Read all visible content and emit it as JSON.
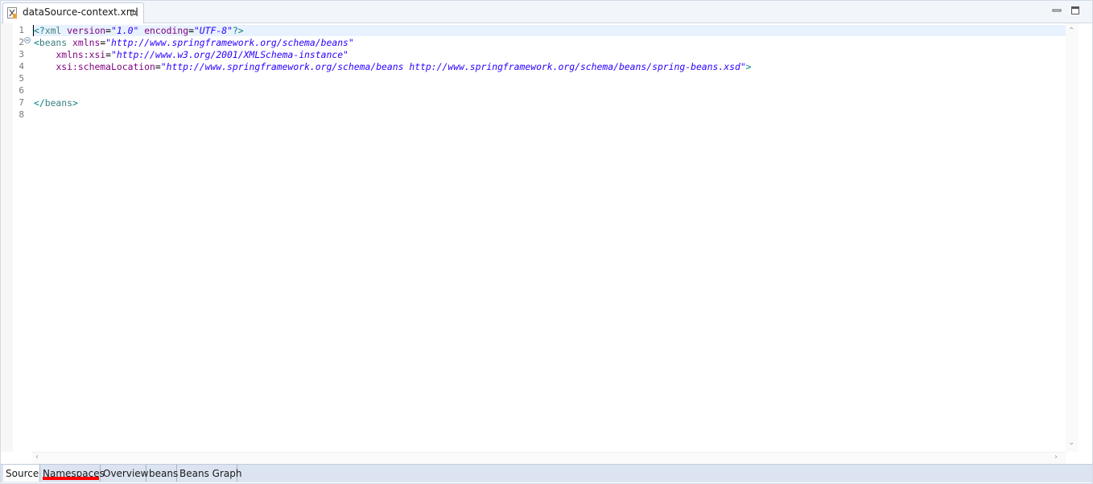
{
  "editor_tab": {
    "title": "dataSource-context.xml",
    "icon": "xml-file-icon",
    "close_icon": "close-icon"
  },
  "window_controls": {
    "minimize_icon": "minimize-icon",
    "maximize_icon": "maximize-icon"
  },
  "editor": {
    "line_numbers": [
      "1",
      "2",
      "3",
      "4",
      "5",
      "6",
      "7",
      "8"
    ],
    "lines": [
      [
        {
          "t": "delim",
          "s": "<?"
        },
        {
          "t": "tag",
          "s": "xml "
        },
        {
          "t": "attr",
          "s": "version"
        },
        {
          "t": "eq",
          "s": "="
        },
        {
          "t": "val",
          "s": "\"1.0\""
        },
        {
          "t": "eq",
          "s": " "
        },
        {
          "t": "attr",
          "s": "encoding"
        },
        {
          "t": "eq",
          "s": "="
        },
        {
          "t": "val",
          "s": "\"UTF-8\""
        },
        {
          "t": "delim",
          "s": "?>"
        }
      ],
      [
        {
          "t": "delim",
          "s": "<"
        },
        {
          "t": "tag",
          "s": "beans "
        },
        {
          "t": "attr",
          "s": "xmlns"
        },
        {
          "t": "eq",
          "s": "="
        },
        {
          "t": "val",
          "s": "\"http://www.springframework.org/schema/beans\""
        }
      ],
      [
        {
          "t": "eq",
          "s": "    "
        },
        {
          "t": "attr",
          "s": "xmlns:xsi"
        },
        {
          "t": "eq",
          "s": "="
        },
        {
          "t": "val",
          "s": "\"http://www.w3.org/2001/XMLSchema-instance\""
        }
      ],
      [
        {
          "t": "eq",
          "s": "    "
        },
        {
          "t": "attr",
          "s": "xsi:schemaLocation"
        },
        {
          "t": "eq",
          "s": "="
        },
        {
          "t": "val",
          "s": "\"http://www.springframework.org/schema/beans http://www.springframework.org/schema/beans/spring-beans.xsd\""
        },
        {
          "t": "delim",
          "s": ">"
        }
      ],
      [],
      [],
      [
        {
          "t": "delim",
          "s": "</"
        },
        {
          "t": "tag",
          "s": "beans"
        },
        {
          "t": "delim",
          "s": ">"
        }
      ],
      []
    ],
    "fold_icon": "collapse-icon"
  },
  "page_tabs": [
    {
      "label": "Source",
      "active": true
    },
    {
      "label": "Namespaces",
      "active": false
    },
    {
      "label": "Overview",
      "active": false
    },
    {
      "label": "beans",
      "active": false
    },
    {
      "label": "Beans Graph",
      "active": false
    }
  ],
  "colors": {
    "delimiter": "#008080",
    "tag": "#3f7f7f",
    "attribute": "#7f007f",
    "value": "#2a00ff",
    "current_line": "#e8f2fe",
    "highlight_underline": "#ff0000"
  }
}
